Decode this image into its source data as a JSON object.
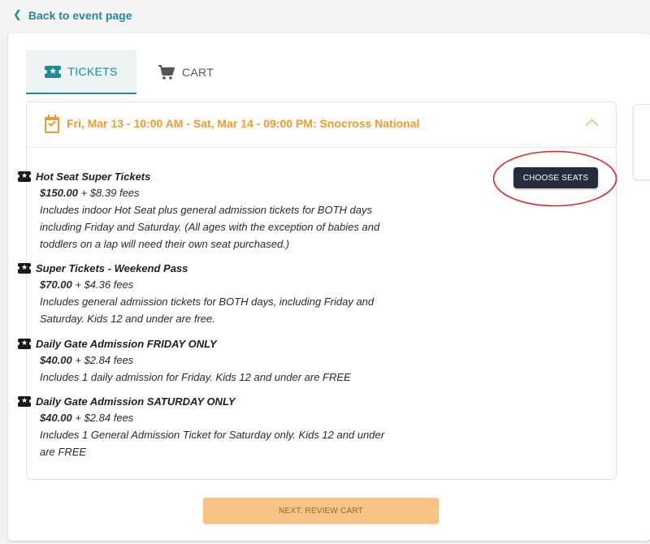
{
  "back_link": {
    "label": "Back to event page"
  },
  "tabs": [
    {
      "label": "TICKETS",
      "icon": "ticket-icon",
      "active": true
    },
    {
      "label": "CART",
      "icon": "cart-icon",
      "active": false
    }
  ],
  "event": {
    "title": "Fri, Mar 13 - 10:00 AM - Sat, Mar 14 - 09:00 PM: Snocross National",
    "icon": "calendar-check-icon",
    "accent_color": "#f29a2e"
  },
  "tickets": [
    {
      "name": "Hot Seat Super Tickets",
      "price": "$150.00",
      "fees": " + $8.39 fees",
      "description_lines": [
        "Includes indoor Hot Seat plus general admission tickets for BOTH days",
        "including Friday and Saturday. (All ages with the exception of babies and",
        "toddlers on a lap will need their own seat purchased.)"
      ]
    },
    {
      "name": "Super Tickets - Weekend Pass",
      "price": "$70.00",
      "fees": " + $4.36 fees",
      "description_lines": [
        "Includes general admission tickets for BOTH days, including Friday and",
        "Saturday. Kids 12 and under are free."
      ]
    },
    {
      "name": "Daily Gate Admission FRIDAY ONLY",
      "price": "$40.00",
      "fees": " + $2.84 fees",
      "description_lines": [
        "Includes 1 daily admission for Friday. Kids 12 and under are FREE"
      ]
    },
    {
      "name": "Daily Gate Admission SATURDAY ONLY",
      "price": "$40.00",
      "fees": " + $2.84 fees",
      "description_lines": [
        "Includes 1 General Admission Ticket for Saturday only. Kids 12 and under",
        "are FREE"
      ]
    }
  ],
  "choose_seats": {
    "label": "CHOOSE SEATS",
    "highlight_color": "#e0262b"
  },
  "next_button": {
    "label": "NEXT: REVIEW CART"
  },
  "colors": {
    "primary": "#1f8a9b",
    "dark_button": "#262c3c",
    "next_button_bg": "#f7c385"
  }
}
